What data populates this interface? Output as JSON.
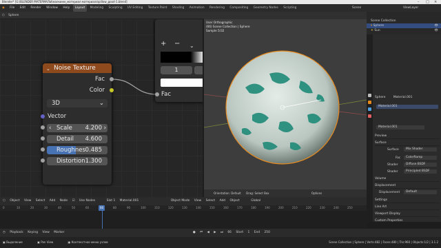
{
  "window": {
    "title": "Blender* [G:\\BLENDER МАТЕРИАЛЫ\\малкинм_материал материала\\pillow_good-1.blend]"
  },
  "menu": {
    "items": [
      "File",
      "Edit",
      "Render",
      "Window",
      "Help"
    ],
    "workspaces": [
      "Layout",
      "Modeling",
      "Sculpting",
      "UV Editing",
      "Texture Paint",
      "Shading",
      "Animation",
      "Rendering",
      "Compositing",
      "Geometry Nodes",
      "Scripting"
    ],
    "active_workspace": "Layout",
    "scene": "Scene",
    "view_layer": "ViewLayer"
  },
  "node_editor_header": {
    "object": "Sphere",
    "object_label": "Object",
    "view": "View",
    "select": "Select",
    "add": "Add",
    "node": "Node",
    "use_nodes": "Use Nodes",
    "slot": "Slot 1",
    "material": "Material.001"
  },
  "noise_node": {
    "title": "Noise Texture",
    "out_fac": "Fac",
    "out_color": "Color",
    "dimension": "3D",
    "vector": "Vector",
    "scale_label": "Scale",
    "scale_value": "4.200",
    "detail_label": "Detail",
    "detail_value": "4.600",
    "roughness_label": "Roughnes",
    "roughness_value": "0.485",
    "distortion_label": "Distortion",
    "distortion_value": "1.300"
  },
  "ramp_node": {
    "add": "+",
    "remove": "−",
    "index": "1",
    "input_fac": "Fac"
  },
  "viewport": {
    "mode": "Object Mode",
    "view": "View",
    "select": "Select",
    "add": "Add",
    "object": "Object",
    "global": "Global",
    "overlay_line1": "User Orthographic",
    "overlay_line2": "(66) Scene Collection | Sphere",
    "overlay_line3": "Sample 5/32",
    "orientation": "Orientation:",
    "orientation_value": "Default",
    "drag": "Drag:",
    "drag_value": "Select Box",
    "options": "Options"
  },
  "outliner": {
    "rows": [
      "Scene Collection",
      "Sphere",
      "Sun"
    ]
  },
  "properties": {
    "object": "Sphere",
    "material": "Material.001",
    "slot_material": "Material.001",
    "material_field": "Material.001",
    "sections": [
      "Preview",
      "Surface",
      "Volume",
      "Displacement",
      "Settings",
      "Line Art",
      "Viewport Display",
      "Custom Properties"
    ],
    "surface_label": "Surface",
    "surface_value": "Mix Shader",
    "fac_label": "Fac",
    "fac_value": "ColorRamp",
    "shader1_label": "Shader",
    "shader1_value": "Diffuse BSDF",
    "shader2_label": "Shader",
    "shader2_value": "Principled BSDF",
    "displacement_label": "Displacement",
    "displacement_value": "Default"
  },
  "timeline": {
    "playback": "Playback",
    "keying": "Keying",
    "view": "View",
    "marker": "Marker",
    "ticks": [
      "0",
      "10",
      "20",
      "30",
      "40",
      "50",
      "60",
      "70",
      "80",
      "90",
      "100",
      "110",
      "120",
      "130",
      "140",
      "150",
      "160",
      "170",
      "180",
      "190",
      "200",
      "210",
      "220",
      "230",
      "240",
      "250"
    ],
    "current_frame": "66",
    "start_label": "Start",
    "start": "1",
    "end_label": "End",
    "end": "250"
  },
  "status": {
    "left": "Выделение",
    "mid": "Pan View",
    "mid2": "Контекстное меню узлов",
    "right": "Scene Collection | Sphere | Verts:482 | Faces:480 | Tris:960 | Objects:1/2 | 3.1.2"
  },
  "colors": {
    "accent": "#4772b3",
    "node_header": "#8e4a1d",
    "selection": "#e78a1e"
  }
}
